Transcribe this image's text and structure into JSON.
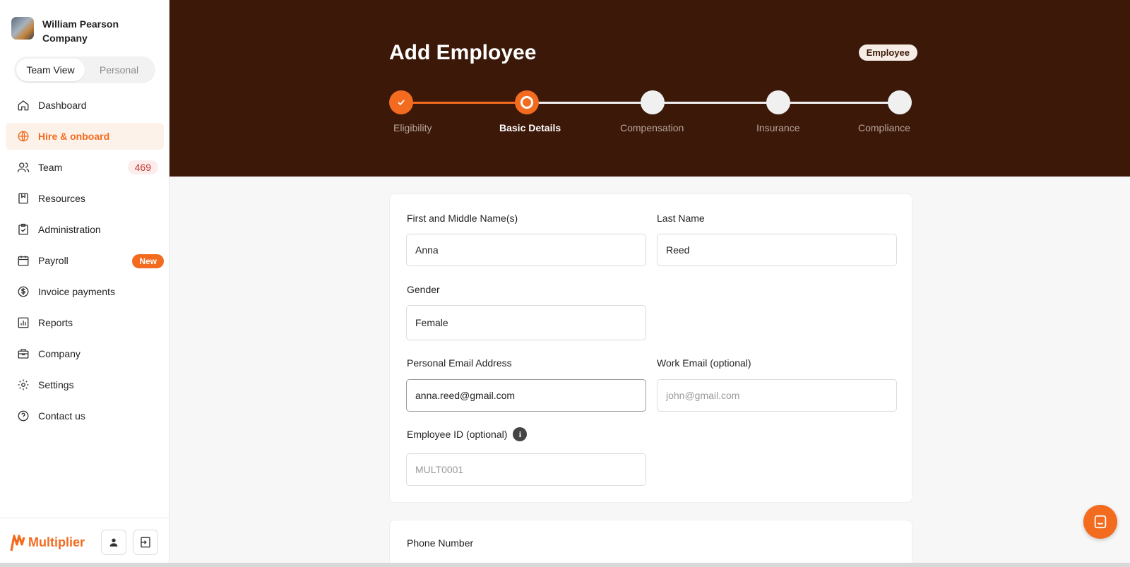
{
  "company": {
    "name": "William Pearson Company"
  },
  "view_toggle": {
    "team": "Team View",
    "personal": "Personal"
  },
  "nav": {
    "dashboard": "Dashboard",
    "hire": "Hire & onboard",
    "team": "Team",
    "team_count": "469",
    "resources": "Resources",
    "administration": "Administration",
    "payroll": "Payroll",
    "payroll_badge": "New",
    "invoice": "Invoice payments",
    "reports": "Reports",
    "company": "Company",
    "settings": "Settings",
    "contact": "Contact us"
  },
  "brand": {
    "name": "Multiplier",
    "color": "#f36b1f"
  },
  "header": {
    "title": "Add Employee",
    "badge": "Employee",
    "bg_color": "#3c1808"
  },
  "stepper": {
    "steps": [
      "Eligibility",
      "Basic Details",
      "Compensation",
      "Insurance",
      "Compliance"
    ],
    "current_step": 2
  },
  "form": {
    "first_name": {
      "label": "First and Middle Name(s)",
      "value": "Anna"
    },
    "last_name": {
      "label": "Last Name",
      "value": "Reed"
    },
    "gender": {
      "label": "Gender",
      "value": "Female"
    },
    "personal_email": {
      "label": "Personal Email Address",
      "value": "anna.reed@gmail.com"
    },
    "work_email": {
      "label": "Work Email (optional)",
      "placeholder": "john@gmail.com"
    },
    "employee_id": {
      "label": "Employee ID (optional)",
      "placeholder": "MULT0001"
    },
    "phone": {
      "label": "Phone Number"
    }
  },
  "icons": {
    "nav": [
      "home-icon",
      "globe-icon",
      "users-icon",
      "resources-icon",
      "clipboard-check-icon",
      "calendar-icon",
      "dollar-icon",
      "bar-chart-icon",
      "briefcase-icon",
      "gear-icon",
      "help-circle-icon"
    ],
    "footer": [
      "user-icon",
      "logout-icon"
    ],
    "chat": "chat-icon",
    "info": "info-icon"
  }
}
